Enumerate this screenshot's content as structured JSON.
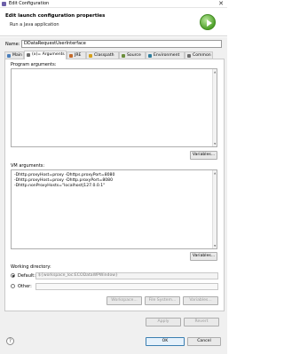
{
  "window": {
    "title": "Edit Configuration",
    "close_glyph": "✕"
  },
  "header": {
    "heading": "Edit launch configuration properties",
    "subtitle": "Run a Java application",
    "icon": "run-icon"
  },
  "name": {
    "label": "Name:",
    "value": "DDataRequestUserInterface"
  },
  "tabs": [
    {
      "label": "Main",
      "icon": "main-class-icon",
      "color": "#4a7ebb"
    },
    {
      "label": "(x)= Arguments",
      "icon": "arguments-icon",
      "color": "#6f6f6f"
    },
    {
      "label": "JRE",
      "icon": "jre-icon",
      "color": "#c46a2a"
    },
    {
      "label": "Classpath",
      "icon": "classpath-icon",
      "color": "#d6a11b"
    },
    {
      "label": "Source",
      "icon": "source-icon",
      "color": "#6b8e3c"
    },
    {
      "label": "Environment",
      "icon": "environment-icon",
      "color": "#2f7d9e"
    },
    {
      "label": "Common",
      "icon": "common-icon",
      "color": "#6d6d6d"
    }
  ],
  "program_args": {
    "label": "Program arguments:",
    "value": "",
    "variables_label": "Variables..."
  },
  "vm_args": {
    "label": "VM arguments:",
    "lines": [
      "-Dhttp.proxyHost=proxy -Dhttps.proxyPort=8080",
      "-Dhttp.proxyHost=proxy -Dhttp.proxyPort=8080",
      "-Dhttp.nonProxyHosts=\"localhost|127.0.0.1\""
    ],
    "variables_label": "Variables..."
  },
  "working_dir": {
    "label": "Working directory:",
    "default_label": "Default:",
    "default_value": "${workspace_loc:ECODataWPWindow}",
    "other_label": "Other:",
    "other_value": "",
    "workspace_label": "Workspace...",
    "filesystem_label": "File System...",
    "variables_label": "Variables..."
  },
  "footer": {
    "apply_label": "Apply",
    "revert_label": "Revert",
    "ok_label": "OK",
    "cancel_label": "Cancel",
    "help_glyph": "?"
  },
  "colors": {
    "accent": "#3c7fb1",
    "run_green": "#4fa12a"
  }
}
